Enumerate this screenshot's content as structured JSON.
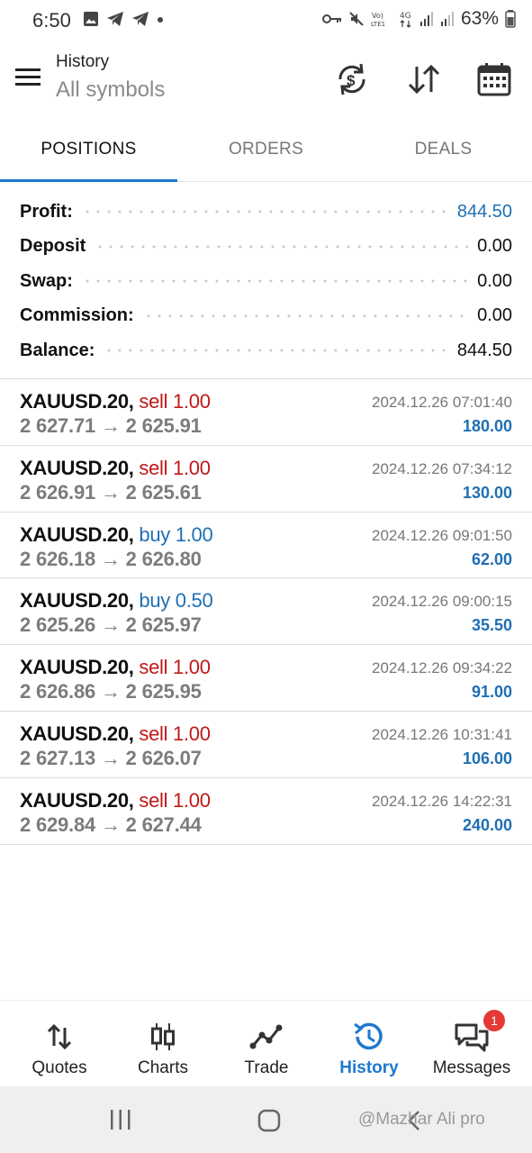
{
  "status_bar": {
    "time": "6:50",
    "battery": "63%",
    "network_label": "4G"
  },
  "app_bar": {
    "title": "History",
    "subtitle": "All symbols"
  },
  "tabs": [
    {
      "label": "POSITIONS",
      "active": true
    },
    {
      "label": "ORDERS",
      "active": false
    },
    {
      "label": "DEALS",
      "active": false
    }
  ],
  "summary": {
    "profit_label": "Profit:",
    "profit_value": "844.50",
    "deposit_label": "Deposit",
    "deposit_value": "0.00",
    "swap_label": "Swap:",
    "swap_value": "0.00",
    "commission_label": "Commission:",
    "commission_value": "0.00",
    "balance_label": "Balance:",
    "balance_value": "844.50"
  },
  "positions": [
    {
      "symbol": "XAUUSD.20,",
      "direction": "sell 1.00",
      "side": "sell",
      "prices": "2 627.71 → 2 625.91",
      "time": "2024.12.26 07:01:40",
      "profit": "180.00"
    },
    {
      "symbol": "XAUUSD.20,",
      "direction": "sell 1.00",
      "side": "sell",
      "prices": "2 626.91 → 2 625.61",
      "time": "2024.12.26 07:34:12",
      "profit": "130.00"
    },
    {
      "symbol": "XAUUSD.20,",
      "direction": "buy 1.00",
      "side": "buy",
      "prices": "2 626.18 → 2 626.80",
      "time": "2024.12.26 09:01:50",
      "profit": "62.00"
    },
    {
      "symbol": "XAUUSD.20,",
      "direction": "buy 0.50",
      "side": "buy",
      "prices": "2 625.26 → 2 625.97",
      "time": "2024.12.26 09:00:15",
      "profit": "35.50"
    },
    {
      "symbol": "XAUUSD.20,",
      "direction": "sell 1.00",
      "side": "sell",
      "prices": "2 626.86 → 2 625.95",
      "time": "2024.12.26 09:34:22",
      "profit": "91.00"
    },
    {
      "symbol": "XAUUSD.20,",
      "direction": "sell 1.00",
      "side": "sell",
      "prices": "2 627.13 → 2 626.07",
      "time": "2024.12.26 10:31:41",
      "profit": "106.00"
    },
    {
      "symbol": "XAUUSD.20,",
      "direction": "sell 1.00",
      "side": "sell",
      "prices": "2 629.84 → 2 627.44",
      "time": "2024.12.26 14:22:31",
      "profit": "240.00"
    }
  ],
  "bottom_nav": [
    {
      "label": "Quotes",
      "icon": "quotes-icon",
      "active": false
    },
    {
      "label": "Charts",
      "icon": "charts-icon",
      "active": false
    },
    {
      "label": "Trade",
      "icon": "trade-icon",
      "active": false
    },
    {
      "label": "History",
      "icon": "history-icon",
      "active": true
    },
    {
      "label": "Messages",
      "icon": "messages-icon",
      "active": false,
      "badge": "1"
    }
  ],
  "watermark": "@Mazhar Ali pro",
  "colors": {
    "accent": "#1e78d0",
    "profit_blue": "#1f6fb3",
    "sell_red": "#c01818"
  }
}
